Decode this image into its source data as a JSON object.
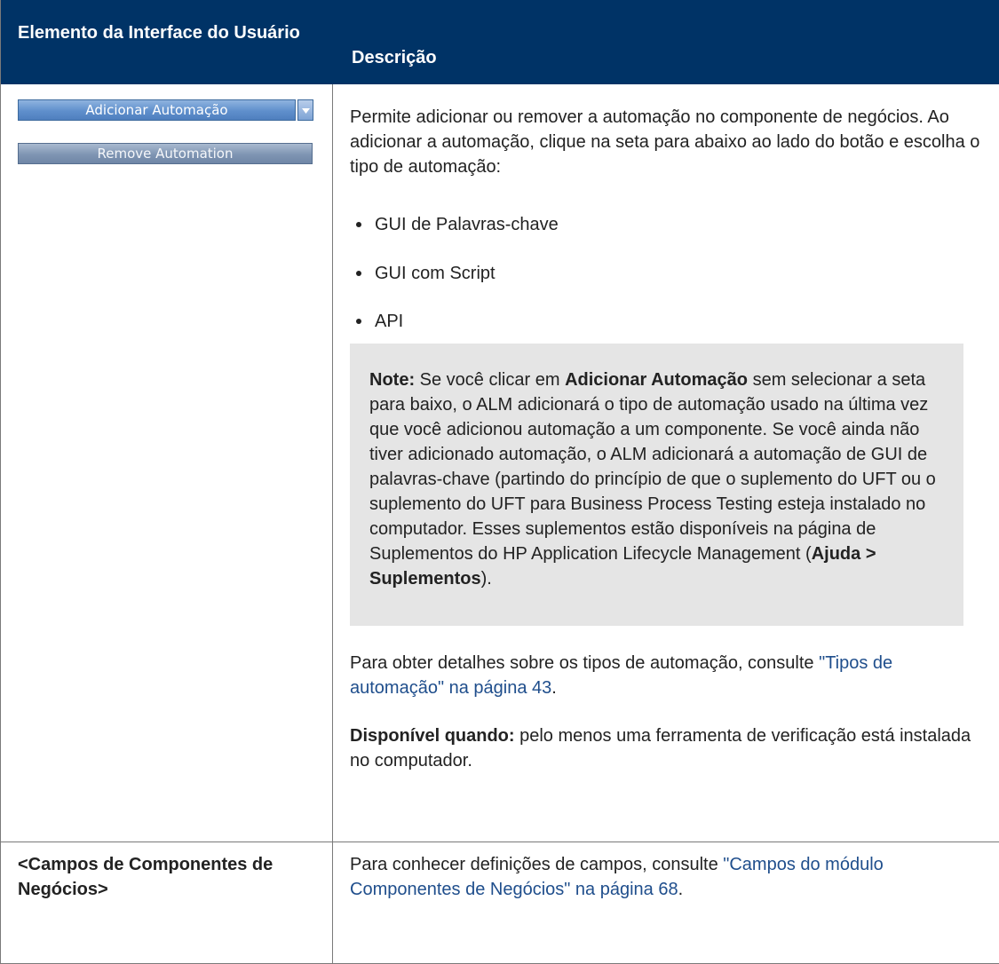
{
  "header": {
    "col1": "Elemento da Interface do Usuário",
    "col2": "Descrição"
  },
  "row1": {
    "buttons": {
      "add_automation": "Adicionar Automação",
      "remove_automation": "Remove Automation"
    },
    "intro": "Permite adicionar ou remover a automação no componente de negócios. Ao adicionar a automação, clique na seta para abaixo ao lado do botão e escolha o tipo de automação:",
    "bullets": [
      "GUI de Palavras-chave",
      "GUI com Script",
      "API"
    ],
    "note": {
      "label": "Note:",
      "p1": " Se você clicar em ",
      "bold1": "Adicionar Automação",
      "p2": " sem selecionar a seta para baixo, o ALM adicionará o tipo de automação usado na última vez que você adicionou automação a um componente. Se você ainda não tiver adicionado automação, o ALM adicionará a automação de GUI de palavras-chave (partindo do princípio de que o suplemento do UFT ou o suplemento do UFT para Business Process Testing esteja instalado no computador. Esses suplementos estão disponíveis na página de Suplementos do HP Application Lifecycle Management (",
      "bold2": "Ajuda > Suplementos",
      "p3": ")."
    },
    "details": {
      "text": "Para obter detalhes sobre os tipos de automação, consulte ",
      "link": "\"Tipos de automação\" na página 43",
      "end": "."
    },
    "available": {
      "label": "Disponível quando:",
      "text": " pelo menos uma ferramenta de verificação está instalada no computador."
    }
  },
  "row2": {
    "element": "<Campos de Componentes de Negócios>",
    "text": "Para conhecer definições de campos, consulte ",
    "link": "\"Campos do módulo Componentes de Negócios\" na página 68",
    "end": "."
  },
  "colors": {
    "header_bg": "#003366",
    "link": "#1f4e8c",
    "note_bg": "#e5e5e5"
  }
}
